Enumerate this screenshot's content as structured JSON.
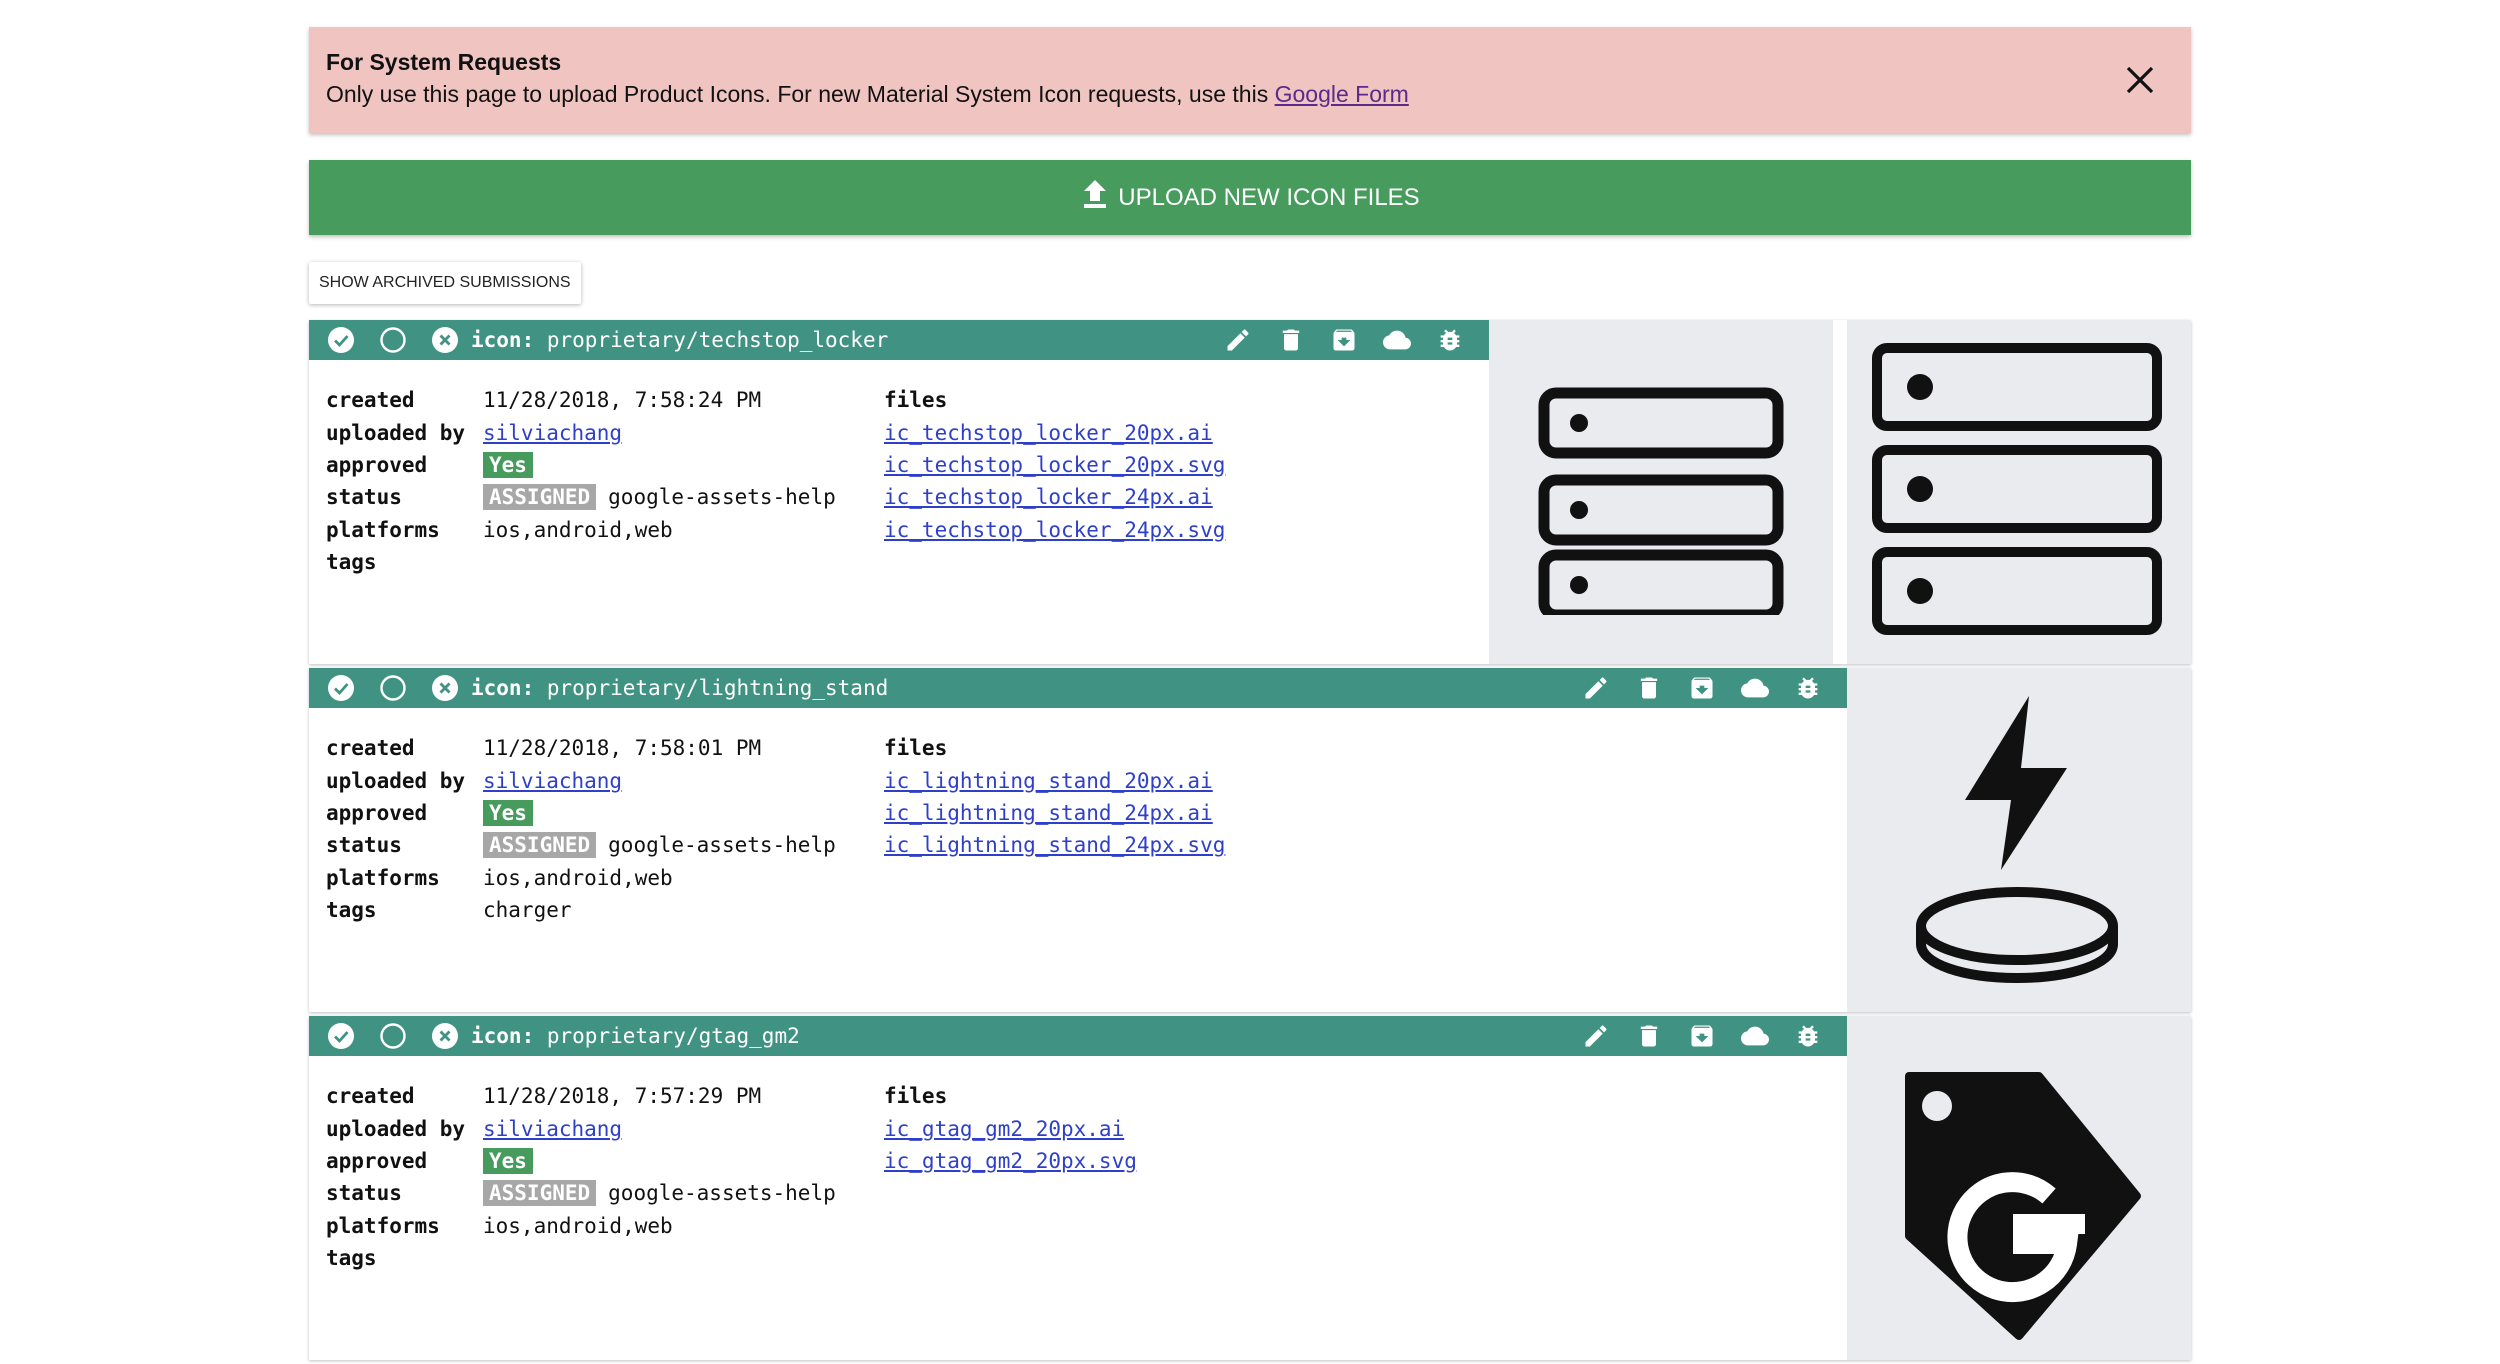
{
  "banner": {
    "title": "For System Requests",
    "message": "Only use this page to upload Product Icons. For new Material System Icon requests, use this ",
    "link_text": "Google Form"
  },
  "upload_label": "UPLOAD NEW ICON FILES",
  "archived_label": "SHOW ARCHIVED SUBMISSIONS",
  "labels": {
    "icon": "icon:",
    "created": "created",
    "uploaded_by": "uploaded by",
    "approved": "approved",
    "status": "status",
    "platforms": "platforms",
    "tags": "tags",
    "files": "files"
  },
  "submissions": [
    {
      "name": "proprietary/techstop_locker",
      "created": "11/28/2018, 7:58:24 PM",
      "uploaded_by": "silviachang",
      "approved": "Yes",
      "status_badge": "ASSIGNED",
      "status_text": "google-assets-help",
      "platforms": "ios,android,web",
      "tags": "",
      "files": [
        "ic_techstop_locker_20px.ai",
        "ic_techstop_locker_20px.svg",
        "ic_techstop_locker_24px.ai",
        "ic_techstop_locker_24px.svg"
      ]
    },
    {
      "name": "proprietary/lightning_stand",
      "created": "11/28/2018, 7:58:01 PM",
      "uploaded_by": "silviachang",
      "approved": "Yes",
      "status_badge": "ASSIGNED",
      "status_text": "google-assets-help",
      "platforms": "ios,android,web",
      "tags": "charger",
      "files": [
        "ic_lightning_stand_20px.ai",
        "ic_lightning_stand_24px.ai",
        "ic_lightning_stand_24px.svg"
      ]
    },
    {
      "name": "proprietary/gtag_gm2",
      "created": "11/28/2018, 7:57:29 PM",
      "uploaded_by": "silviachang",
      "approved": "Yes",
      "status_badge": "ASSIGNED",
      "status_text": "google-assets-help",
      "platforms": "ios,android,web",
      "tags": "",
      "files": [
        "ic_gtag_gm2_20px.ai",
        "ic_gtag_gm2_20px.svg"
      ]
    }
  ]
}
